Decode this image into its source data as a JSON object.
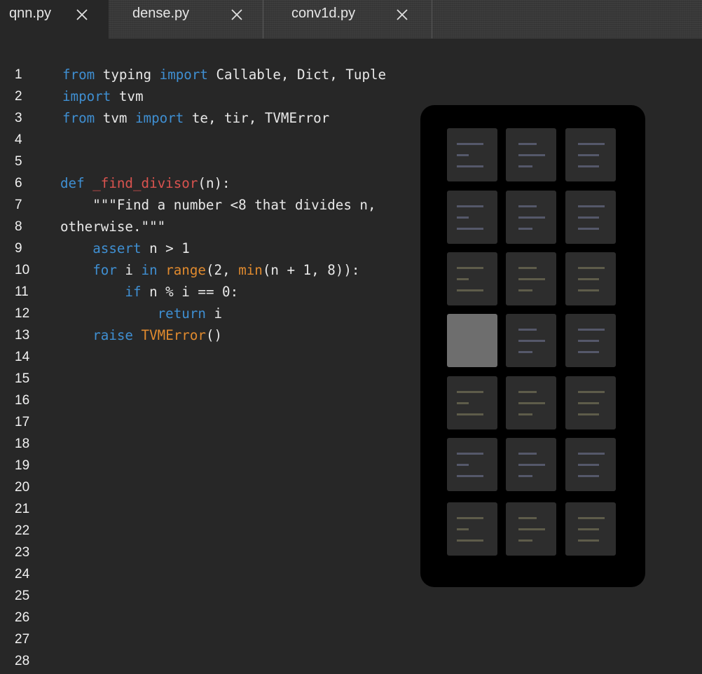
{
  "tabs": [
    {
      "label": "qnn.py",
      "active": true
    },
    {
      "label": "dense.py",
      "active": false
    },
    {
      "label": "conv1d.py",
      "active": false
    }
  ],
  "gutter": {
    "line_numbers": [
      "1",
      "2",
      "3",
      "4",
      "5",
      "6",
      "7",
      "8",
      "9",
      "10",
      "11",
      "12",
      "13",
      "14",
      "15",
      "16",
      "17",
      "18",
      "19",
      "20",
      "21",
      "22",
      "23",
      "24",
      "25",
      "26",
      "27",
      "28"
    ]
  },
  "code": {
    "l1": {
      "a": "from",
      "b": " typing ",
      "c": "import",
      "d": " Callable, Dict, Tuple"
    },
    "l2": {
      "a": "import",
      "b": " tvm"
    },
    "l3": {
      "a": "from",
      "b": " tvm ",
      "c": "import",
      "d": " te, tir, TVMError"
    },
    "l6": {
      "a": "def",
      "b": " ",
      "c": "_find_divisor",
      "d": "(n):"
    },
    "l7": {
      "a": "    \"\"\"Find a number <8 that divides n,"
    },
    "l8": {
      "a": "otherwise.\"\"\""
    },
    "l9": {
      "a": "    ",
      "b": "assert",
      "c": " n > 1"
    },
    "l10": {
      "a": "    ",
      "b": "for",
      "c": " i ",
      "d": "in",
      "e": " ",
      "f": "range",
      "g": "(2, ",
      "h": "min",
      "i": "(n + 1, 8)):"
    },
    "l11": {
      "a": "        ",
      "b": "if",
      "c": " n % i == 0:"
    },
    "l12": {
      "a": "            ",
      "b": "return",
      "c": " i"
    },
    "l13": {
      "a": "    ",
      "b": "raise",
      "c": " ",
      "d": "TVMError",
      "e": "()"
    }
  },
  "switcher": {
    "rows": 7,
    "cols": 3,
    "selected_index": 9
  },
  "colors": {
    "background": "#272727",
    "tabbar": "#383838",
    "keyword": "#3f8fd2",
    "function_name": "#d9534f",
    "builtin": "#e08a2e",
    "text": "#e8e8e8",
    "switcher_bg": "#000000"
  }
}
